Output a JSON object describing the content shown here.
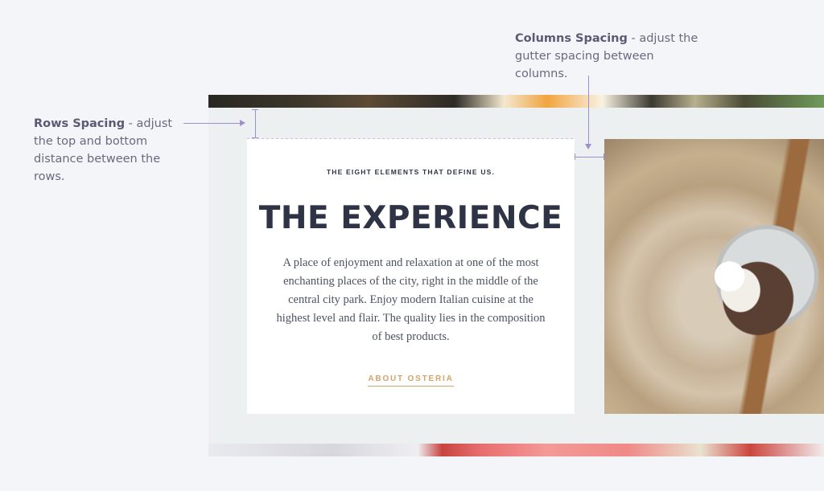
{
  "annotations": {
    "rows": {
      "title": "Rows Spacing",
      "text": " - adjust the top and bottom distance between the rows."
    },
    "columns": {
      "title": "Columns Spacing",
      "text": " - adjust the gutter spacing between columns."
    }
  },
  "card": {
    "eyebrow": "THE EIGHT ELEMENTS THAT DEFINE US.",
    "heading": "THE EXPERIENCE",
    "body": "A place of enjoyment and relaxation at one of the most enchanting places of the city, right in the middle of the central city park. Enjoy modern Italian cuisine at the highest level and flair. The quality lies in the composition of best products.",
    "link": "ABOUT OSTERIA"
  },
  "colors": {
    "accent": "#d3a36a",
    "guide": "#9a8fd0",
    "heading": "#2e3445"
  }
}
